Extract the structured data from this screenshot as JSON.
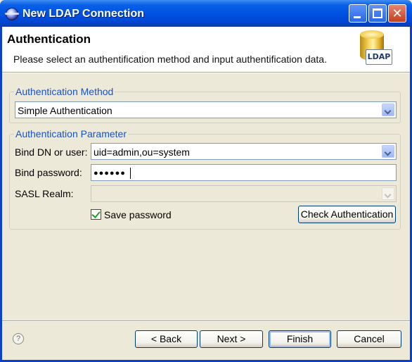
{
  "window": {
    "title": "New LDAP Connection",
    "close_glyph": "✕"
  },
  "header": {
    "title": "Authentication",
    "description": "Please select an authentification method and input authentification data.",
    "icon_label": "LDAP",
    "icon": "ldap-database-icon"
  },
  "auth_method": {
    "group_label": "Authentication Method",
    "selected": "Simple Authentication"
  },
  "auth_params": {
    "group_label": "Authentication Parameter",
    "bind_dn_label": "Bind DN or user:",
    "bind_dn_value": "uid=admin,ou=system",
    "bind_password_label": "Bind password:",
    "bind_password_value": "●●●●●●",
    "sasl_realm_label": "SASL Realm:",
    "sasl_realm_value": "",
    "save_password_label": "Save password",
    "save_password_checked": true,
    "check_button_label": "Check Authentication"
  },
  "footer": {
    "help_icon": "?",
    "back_label": "< Back",
    "next_label": "Next >",
    "finish_label": "Finish",
    "cancel_label": "Cancel"
  },
  "colors": {
    "titlebar": "#0055e5",
    "group_label": "#1a52c7",
    "dialog_bg": "#ece9d8"
  }
}
